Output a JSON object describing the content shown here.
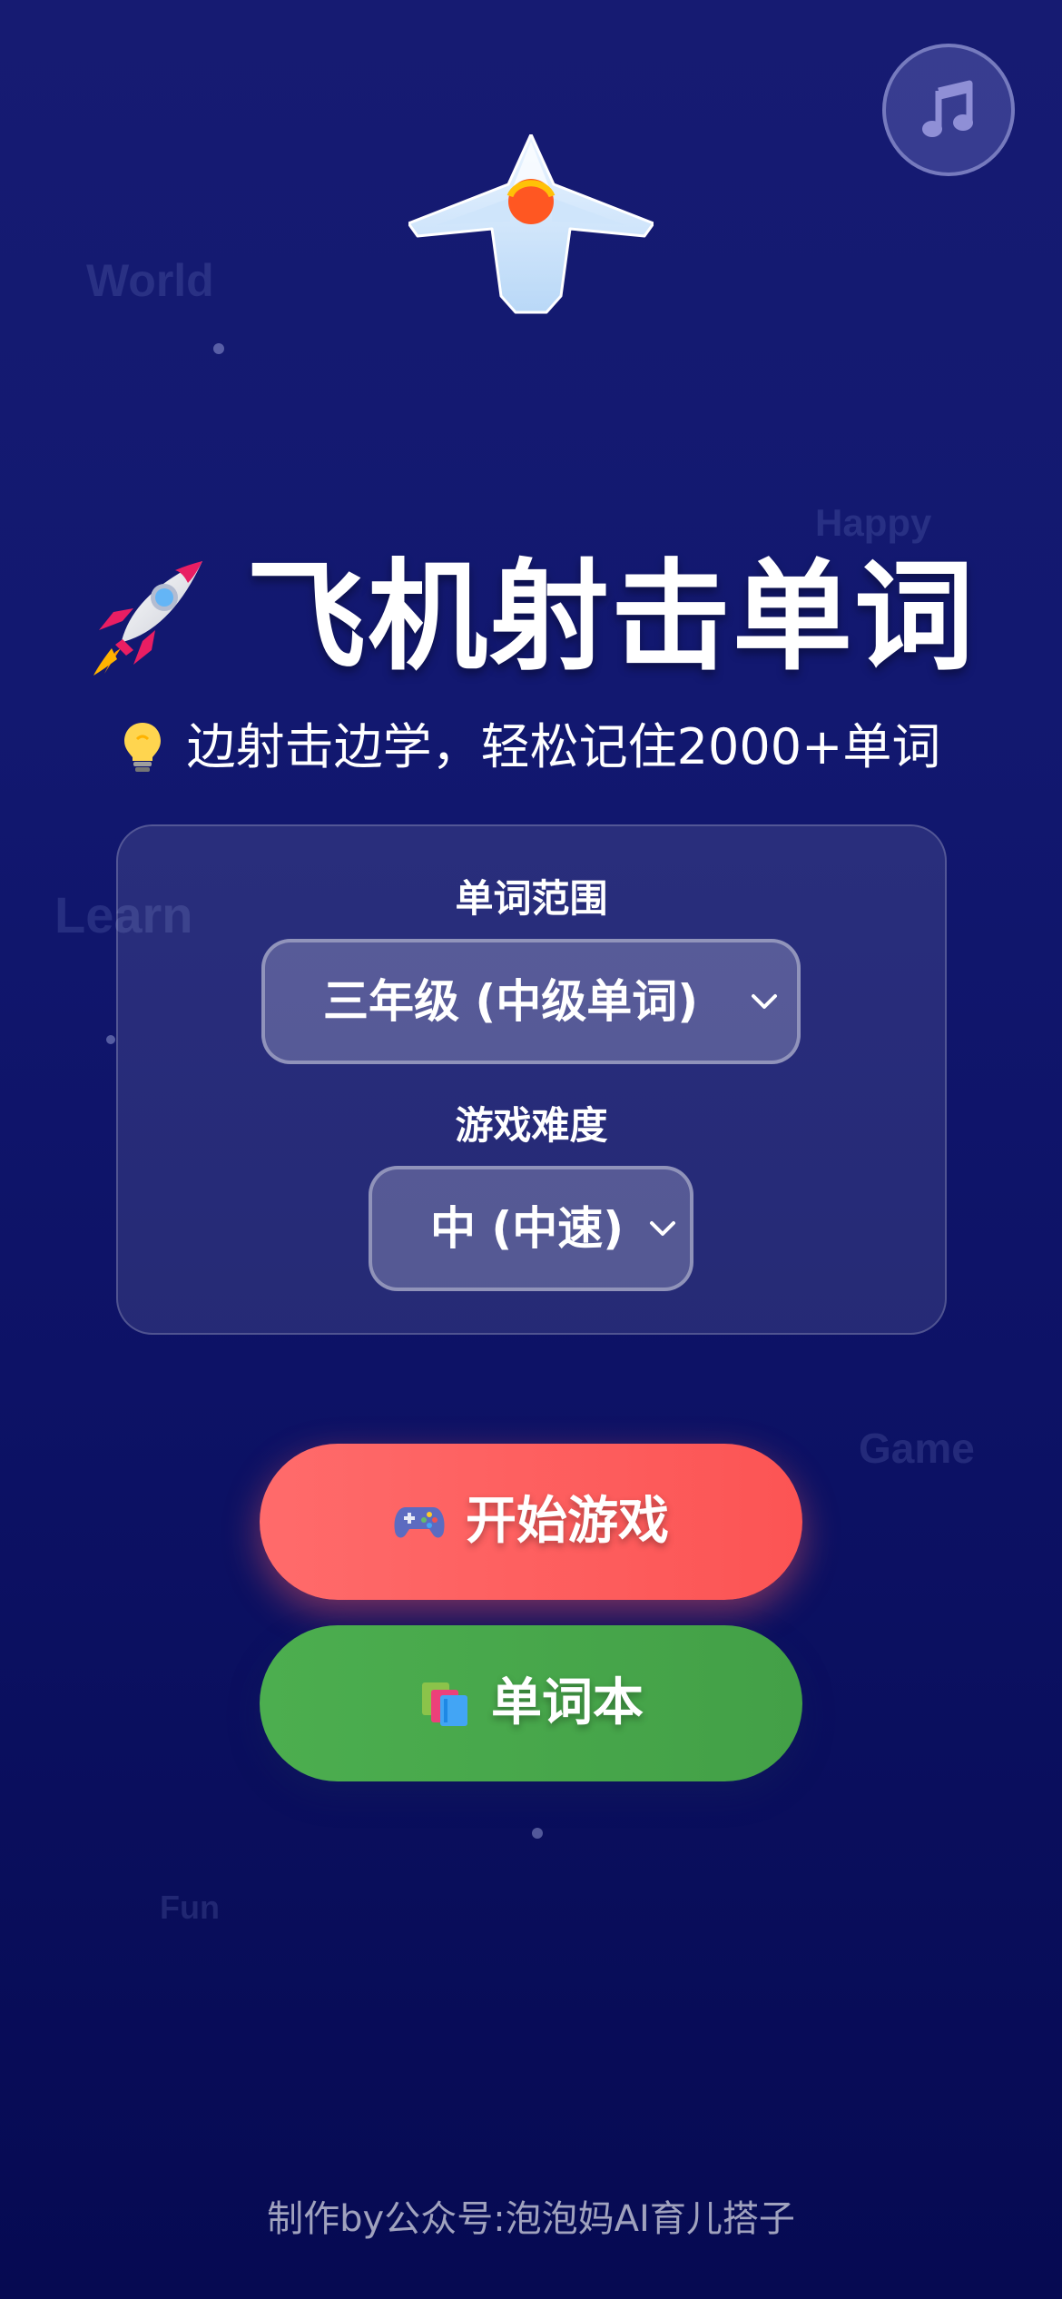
{
  "background_words": [
    "World",
    "Happy",
    "Learn",
    "Game",
    "Fun"
  ],
  "music_button": {
    "icon": "music-note-icon"
  },
  "hero": {
    "icon": "plane-icon"
  },
  "title": {
    "icon": "rocket-icon",
    "text": "飞机射击单词"
  },
  "subtitle": {
    "icon": "lightbulb-icon",
    "text": "边射击边学，轻松记住2000+单词"
  },
  "settings": {
    "range_label": "单词范围",
    "range_value": "三年级 (中级单词)",
    "difficulty_label": "游戏难度",
    "difficulty_value": "中 (中速)"
  },
  "buttons": {
    "start": {
      "icon": "gamepad-icon",
      "label": "开始游戏"
    },
    "wordbook": {
      "icon": "books-icon",
      "label": "单词本"
    }
  },
  "footer": {
    "text": "制作by公众号:泡泡妈AI育儿搭子"
  },
  "colors": {
    "background_top": "#161b72",
    "background_bottom": "#060a52",
    "start_button": "#ff6b6b",
    "wordbook_button": "#4cae4f"
  }
}
